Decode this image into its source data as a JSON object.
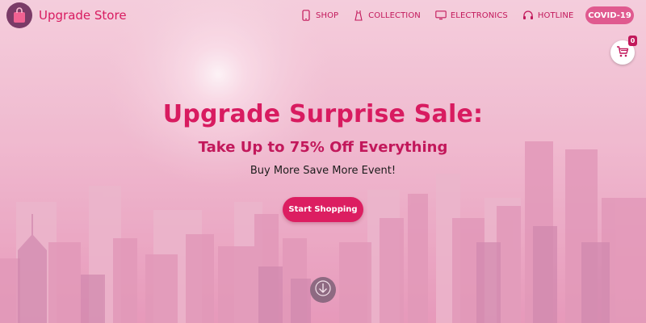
{
  "brand": {
    "name": "Upgrade Store",
    "logo_icon": "shopping-bag-icon"
  },
  "nav": {
    "items": [
      {
        "label": "SHOP",
        "icon": "phone-icon"
      },
      {
        "label": "COLLECTION",
        "icon": "dress-icon"
      },
      {
        "label": "ELECTRONICS",
        "icon": "monitor-icon"
      },
      {
        "label": "HOTLINE",
        "icon": "headset-icon"
      }
    ]
  },
  "covid_button": {
    "label": "COVID-19"
  },
  "cart": {
    "count": "0",
    "icon": "cart-icon"
  },
  "hero": {
    "title": "Upgrade Surprise Sale:",
    "subtitle": "Take Up to 75% Off Everything",
    "tagline": "Buy More Save More Event!",
    "cta_label": "Start Shopping",
    "scroll_icon": "arrow-down-icon"
  },
  "colors": {
    "accent": "#d81b60",
    "nav_text": "#c2185b",
    "button": "#dc1e61",
    "covid_button": "#e05a8f",
    "background": "#e9a7c4"
  }
}
